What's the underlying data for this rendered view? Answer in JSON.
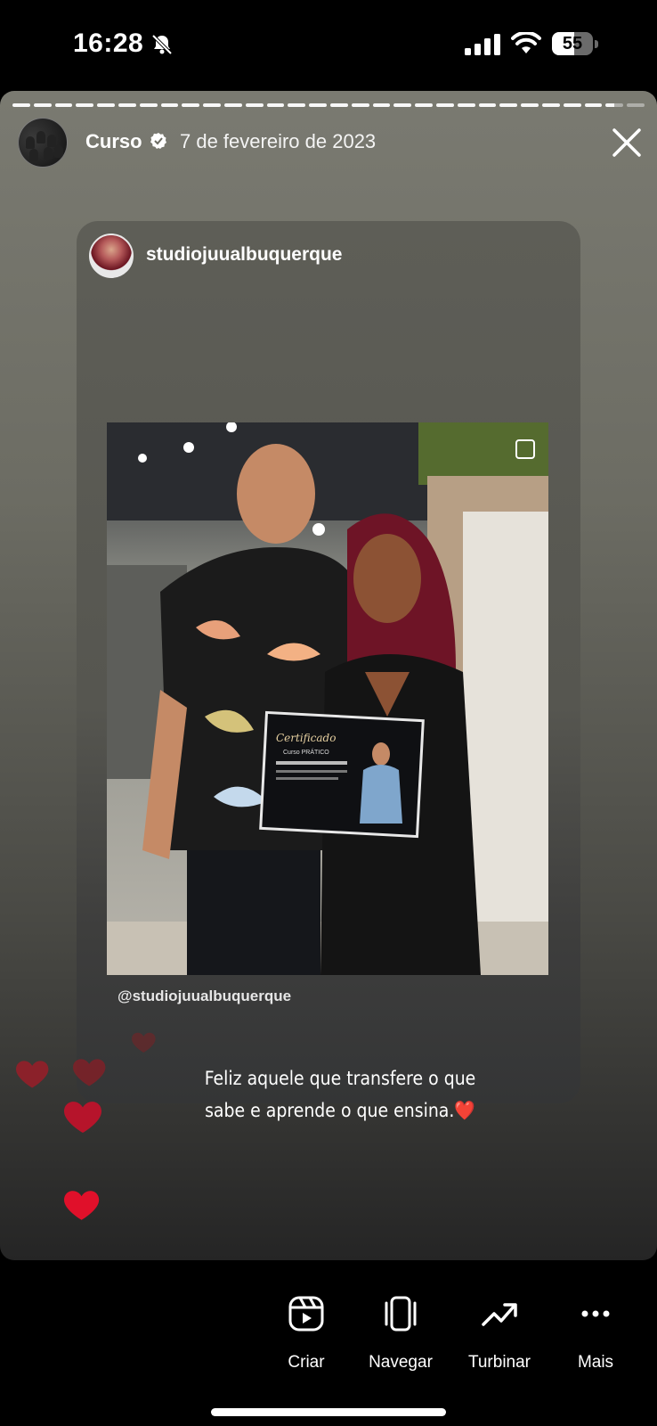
{
  "status_bar": {
    "time": "16:28",
    "battery": "55",
    "battery_level": 0.55
  },
  "story": {
    "progress": {
      "segments_total": 30,
      "segments_viewed": 28
    },
    "author": "Curso",
    "date": "7 de fevereiro de 2023",
    "shared_post": {
      "username": "studiojuualbuquerque",
      "mention": "@studiojuualbuquerque",
      "certificate": {
        "title": "Certificado",
        "subtitle": "Curso PRÁTICO"
      },
      "caption": "Feliz aquele que transfere o que sabe e aprende o que ensina.❤️"
    }
  },
  "actions": [
    {
      "label": "Criar",
      "icon": "reels-create-icon"
    },
    {
      "label": "Navegar",
      "icon": "browse-icon"
    },
    {
      "label": "Turbinar",
      "icon": "boost-trend-icon"
    },
    {
      "label": "Mais",
      "icon": "more-dots-icon"
    }
  ],
  "colors": {
    "heart": "#e0102a",
    "background": "#000000"
  }
}
